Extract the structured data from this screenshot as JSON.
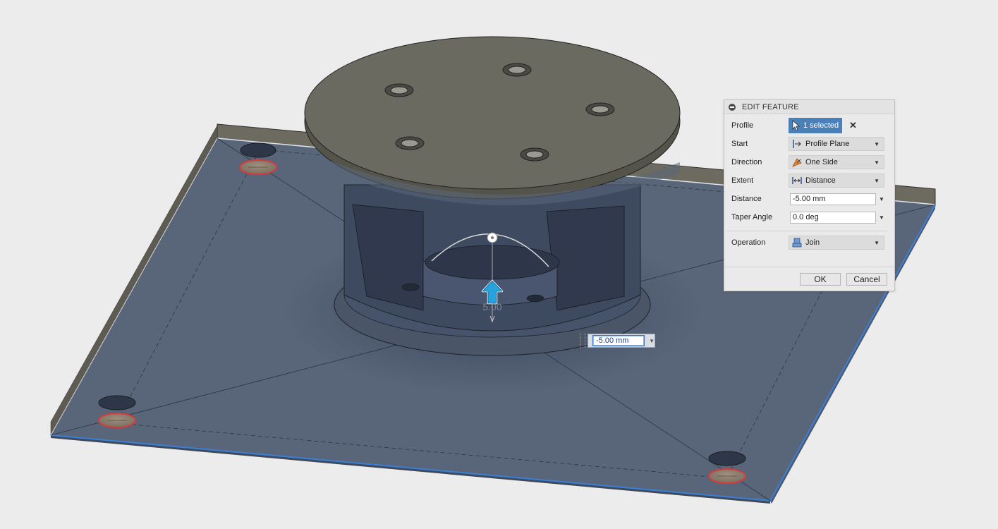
{
  "dialog": {
    "title": "EDIT FEATURE",
    "rows": {
      "profile": {
        "label": "Profile",
        "value": "1 selected"
      },
      "start": {
        "label": "Start",
        "value": "Profile Plane",
        "icon": "profile-plane-icon"
      },
      "direction": {
        "label": "Direction",
        "value": "One Side",
        "icon": "one-side-icon"
      },
      "extent": {
        "label": "Extent",
        "value": "Distance",
        "icon": "distance-icon"
      },
      "distance": {
        "label": "Distance",
        "value": "-5.00 mm"
      },
      "taper": {
        "label": "Taper Angle",
        "value": "0.0 deg"
      },
      "operation": {
        "label": "Operation",
        "value": "Join",
        "icon": "join-icon"
      }
    },
    "ok_label": "OK",
    "cancel_label": "Cancel"
  },
  "viewport": {
    "dimension_input_value": "-5.00 mm",
    "manipulator_label": "5.00"
  },
  "colors": {
    "plate_top": "#59667a",
    "disc_top": "#6b6a60",
    "edge_highlight": "#3c7fd8",
    "selected_button": "#4b7fb8",
    "hole_highlight": "#d63a3a"
  }
}
